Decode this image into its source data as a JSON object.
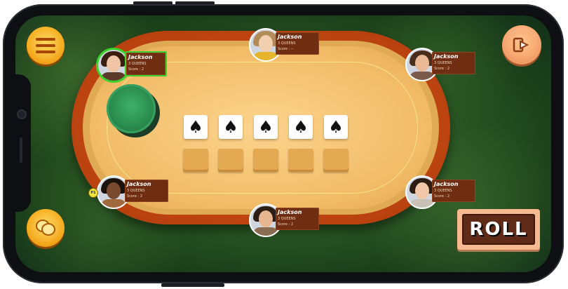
{
  "table": {
    "cards": [
      "♠",
      "♠",
      "♠",
      "♠",
      "♠"
    ],
    "empty_slots": 5
  },
  "players": [
    {
      "id": "top-left",
      "name": "Jackson",
      "line1": "3 QUEENS",
      "line2": "Score : 2",
      "active": true
    },
    {
      "id": "top-center",
      "name": "Jackson",
      "line1": "3 QUEENS",
      "line2": "Score : --",
      "active": false
    },
    {
      "id": "top-right",
      "name": "Jackson",
      "line1": "3 QUEENS",
      "line2": "Score : 2",
      "active": false
    },
    {
      "id": "bottom-left",
      "name": "Jackson",
      "line1": "3 QUEENS",
      "line2": "Score : 2",
      "active": false,
      "badge": "P1"
    },
    {
      "id": "bottom-center",
      "name": "Jackson",
      "line1": "3 QUEENS",
      "line2": "Score : 2",
      "active": false
    },
    {
      "id": "bottom-right",
      "name": "Jackson",
      "line1": "3 QUEENS",
      "line2": "Score : 2",
      "active": false
    }
  ],
  "buttons": {
    "menu_icon": "hamburger-menu-icon",
    "share_icon": "share-arrow-icon",
    "chat_icon": "chat-bubbles-icon",
    "roll_label": "ROLL"
  },
  "colors": {
    "active_border": "#3ad22b",
    "felt": "#fcd48d",
    "rim": "#c8470f",
    "chip": "#2a8d4f"
  }
}
